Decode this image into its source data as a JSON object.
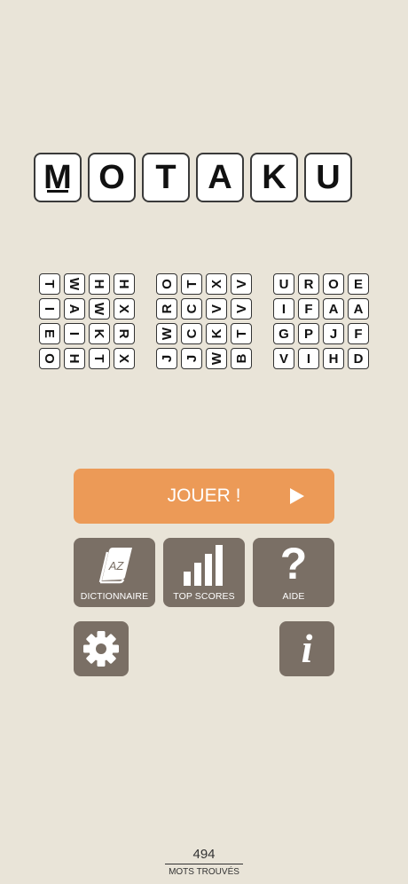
{
  "title": {
    "letters": [
      "M",
      "O",
      "T",
      "A",
      "K",
      "U"
    ]
  },
  "grids": [
    {
      "rows": [
        [
          "T",
          "W",
          "H",
          "H"
        ],
        [
          "I",
          "A",
          "W",
          "X"
        ],
        [
          "E",
          "I",
          "K",
          "R"
        ],
        [
          "O",
          "H",
          "T",
          "X"
        ]
      ]
    },
    {
      "rows": [
        [
          "O",
          "T",
          "X",
          "V"
        ],
        [
          "R",
          "C",
          "V",
          "V"
        ],
        [
          "W",
          "C",
          "K",
          "T"
        ],
        [
          "J",
          "J",
          "W",
          "B"
        ]
      ]
    },
    {
      "rows": [
        [
          "U",
          "R",
          "O",
          "E"
        ],
        [
          "I",
          "F",
          "A",
          "A"
        ],
        [
          "G",
          "P",
          "J",
          "F"
        ],
        [
          "V",
          "I",
          "H",
          "D"
        ]
      ]
    }
  ],
  "buttons": {
    "play_label": "JOUER !",
    "dictionary_label": "DICTIONNAIRE",
    "dictionary_icon_text": "AZ",
    "top_scores_label": "TOP SCORES",
    "help_label": "AIDE",
    "help_icon_text": "?",
    "info_icon_text": "i"
  },
  "footer": {
    "count": "494",
    "label": "MOTS TROUVÉS"
  },
  "colors": {
    "background": "#e9e4d8",
    "accent": "#ec9a57",
    "button": "#7a6f65"
  },
  "icons": [
    "book-icon",
    "bar-chart-icon",
    "question-icon",
    "gear-icon",
    "info-icon",
    "play-icon"
  ]
}
